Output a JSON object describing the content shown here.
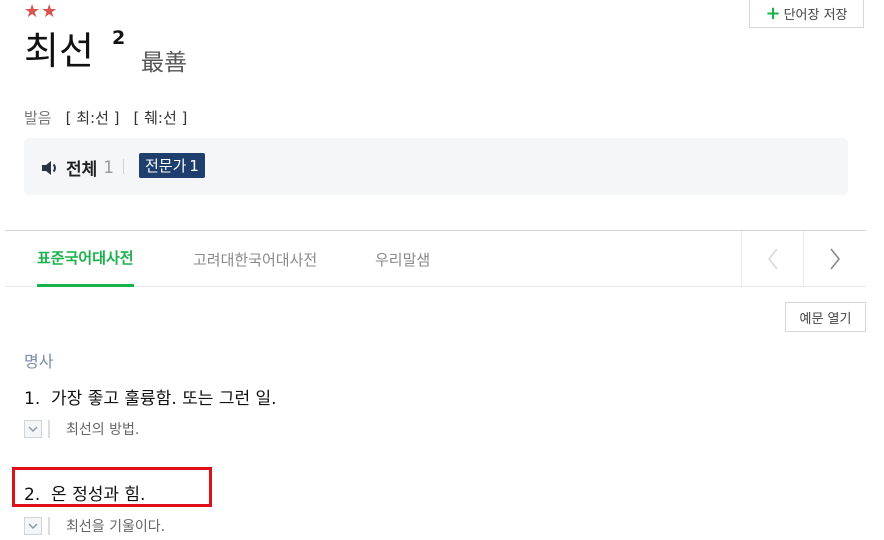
{
  "entry": {
    "stars": "★★",
    "word": "최선",
    "homonym_number": "2",
    "hanja": "最善",
    "save_button_label": "단어장 저장",
    "save_button_icon": "plus-icon"
  },
  "pronunciation": {
    "label": "발음",
    "variants": [
      "[ 최:선 ]",
      "[ 췌:선 ]"
    ]
  },
  "audio": {
    "all_label": "전체",
    "all_count": "1",
    "expert_label": "전문가",
    "expert_count": "1",
    "speaker_icon": "speaker-icon"
  },
  "tabs": [
    {
      "label": "표준국어대사전",
      "active": true
    },
    {
      "label": "고려대한국어대사전",
      "active": false
    },
    {
      "label": "우리말샘",
      "active": false
    }
  ],
  "examples_toggle_label": "예문 열기",
  "part_of_speech": "명사",
  "senses": [
    {
      "number": "1.",
      "definition": "가장 좋고 훌륭함. 또는 그런 일.",
      "example": "최선의 방법."
    },
    {
      "number": "2.",
      "definition": "온 정성과 힘.",
      "example": "최선을 기울이다."
    }
  ],
  "colors": {
    "accent_green": "#19b24b",
    "badge_navy": "#1e3f6e",
    "star_red": "#d9534f",
    "highlight_red": "#e0101a"
  }
}
